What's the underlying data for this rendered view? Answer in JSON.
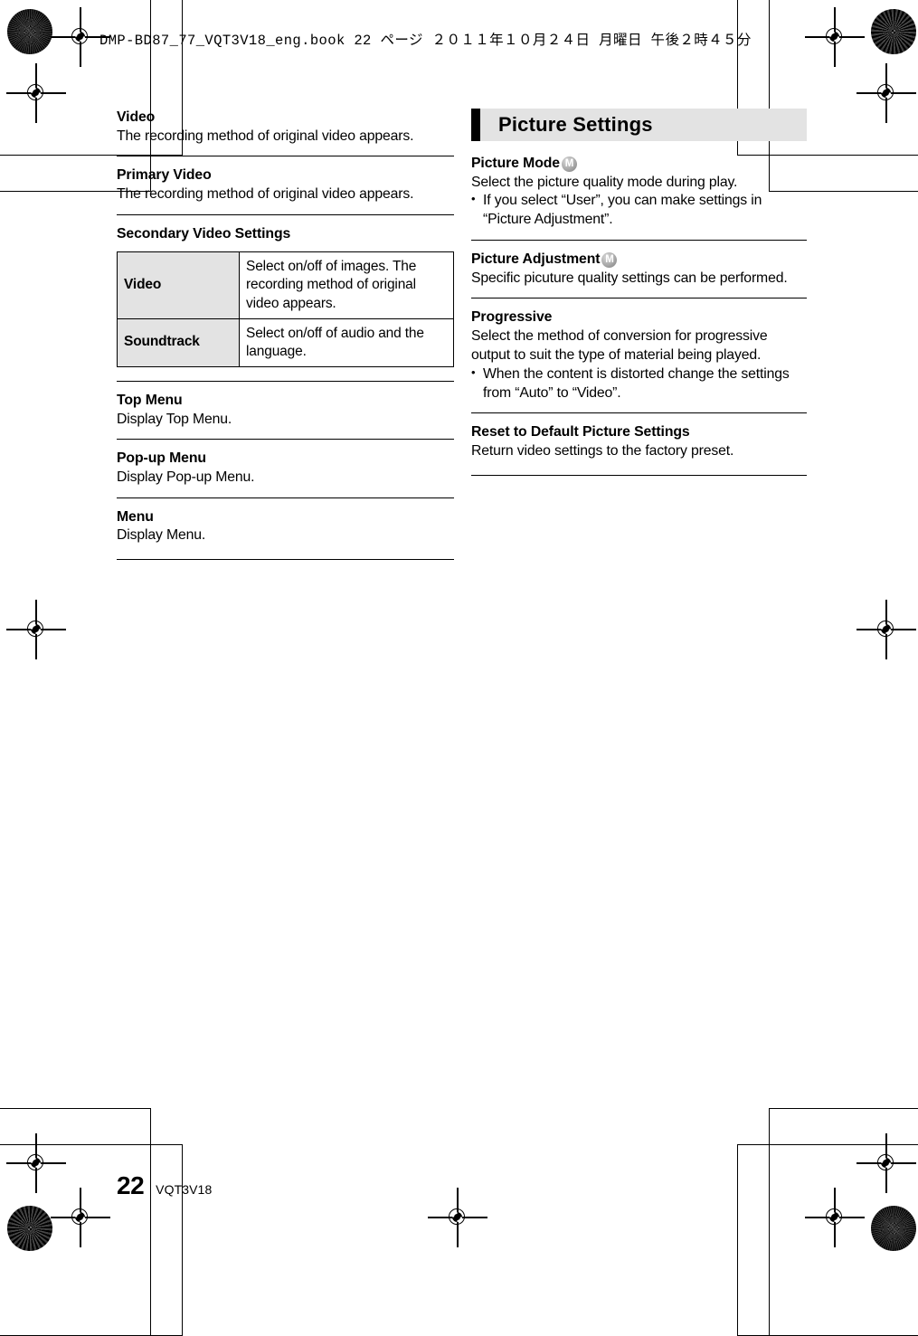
{
  "book_header": "DMP-BD87_77_VQT3V18_eng.book  22 ページ  ２０１１年１０月２４日  月曜日  午後２時４５分",
  "left_column": {
    "sections": [
      {
        "heading": "Video",
        "body": "The recording method of original video appears."
      },
      {
        "heading": "Primary Video",
        "body": "The recording method of original video appears."
      },
      {
        "heading": "Secondary Video Settings",
        "body": ""
      }
    ],
    "table": {
      "rows": [
        {
          "key": "Video",
          "value": "Select on/off of images. The recording method of original video appears."
        },
        {
          "key": "Soundtrack",
          "value": "Select on/off of audio and the language."
        }
      ]
    },
    "sections2": [
      {
        "heading": "Top Menu",
        "body": "Display Top Menu."
      },
      {
        "heading": "Pop-up Menu",
        "body": "Display Pop-up Menu."
      },
      {
        "heading": "Menu",
        "body": "Display Menu."
      }
    ]
  },
  "right_column": {
    "banner_title": "Picture Settings",
    "sections": [
      {
        "heading": "Picture Mode",
        "badge": "M",
        "body": "Select the picture quality mode during play.",
        "bullets": [
          "If you select “User”, you can make settings in “Picture Adjustment”."
        ]
      },
      {
        "heading": "Picture Adjustment",
        "badge": "M",
        "body": "Specific picuture quality settings can be performed.",
        "bullets": []
      },
      {
        "heading": "Progressive",
        "badge": "",
        "body": "Select the method of conversion for progressive output to suit the type of material being played.",
        "bullets": [
          "When the content is distorted change the settings from “Auto” to “Video”."
        ]
      },
      {
        "heading": "Reset to Default Picture Settings",
        "badge": "",
        "body": "Return video settings to the factory preset.",
        "bullets": []
      }
    ]
  },
  "footer": {
    "page_number": "22",
    "document_id": "VQT3V18"
  },
  "colors": {
    "banner_bg": "#e3e3e3",
    "table_key_bg": "#e3e3e3",
    "rule": "#000000",
    "badge": "#a9a9a9"
  }
}
